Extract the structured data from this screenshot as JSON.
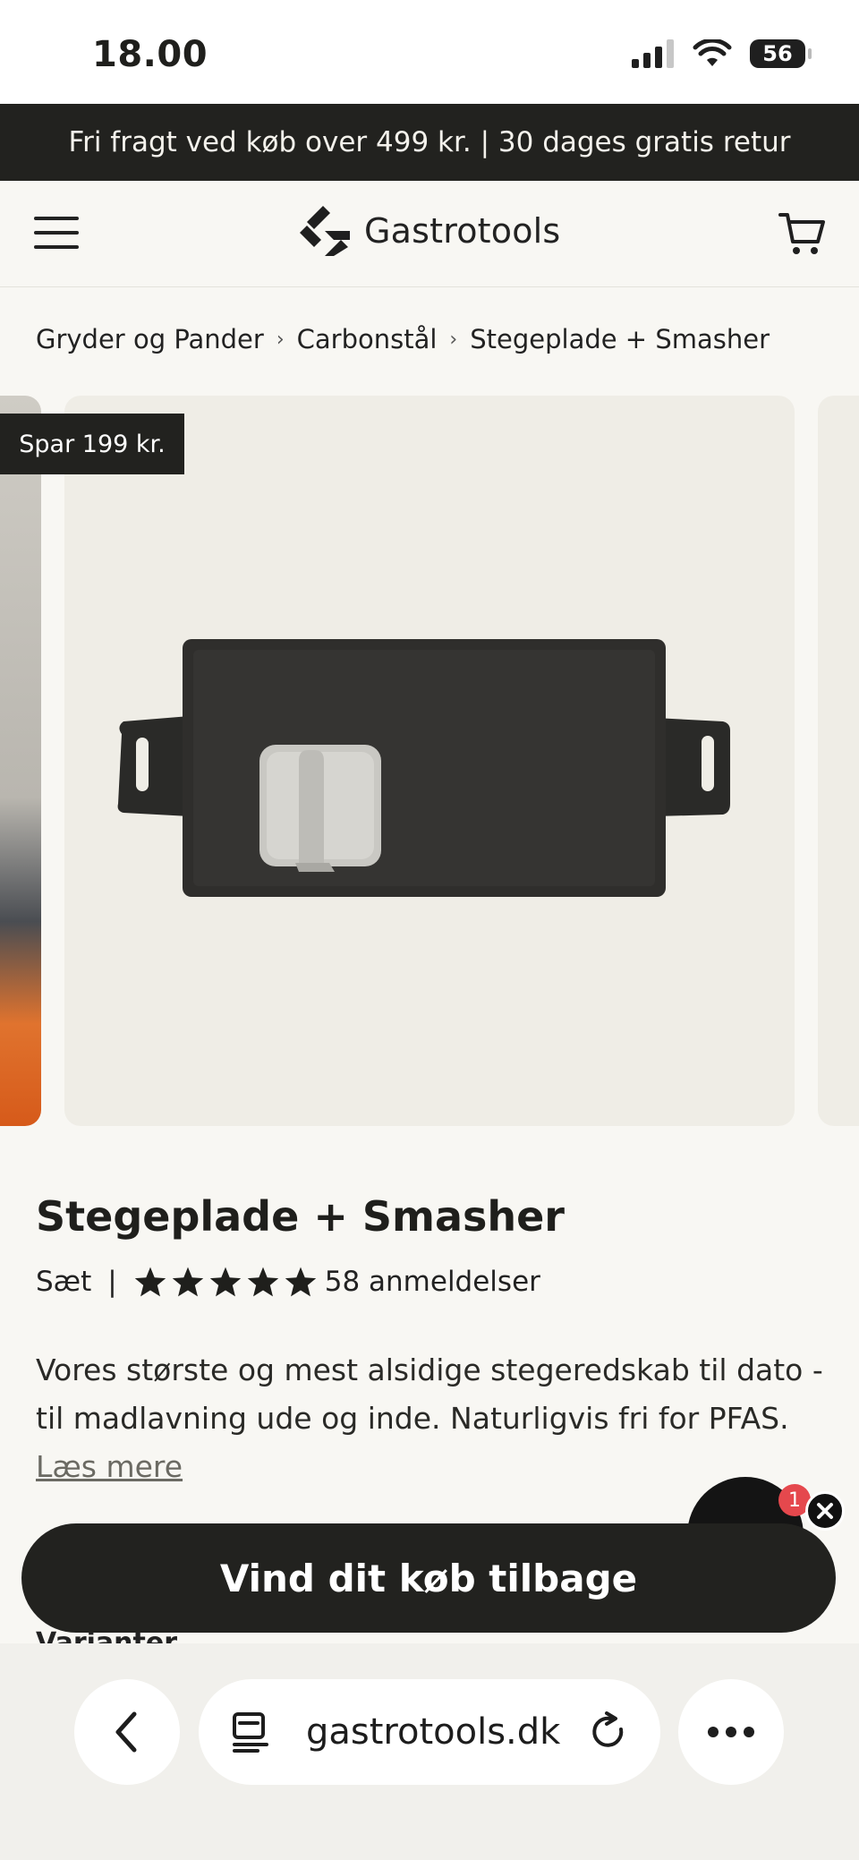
{
  "status_bar": {
    "time": "18.00",
    "battery": "56"
  },
  "promo": {
    "text": "Fri fragt ved køb over 499 kr. | 30 dages gratis retur"
  },
  "header": {
    "logo_text": "Gastrotools"
  },
  "breadcrumb": [
    "Gryder og Pander",
    "Carbonstål",
    "Stegeplade + Smasher"
  ],
  "gallery": {
    "badge": "Spar 199 kr."
  },
  "product": {
    "title": "Stegeplade + Smasher",
    "type": "Sæt",
    "separator": "|",
    "rating": 5,
    "reviews": "58 anmeldelser",
    "description": "Vores største og mest alsidige stegeredskab til dato - til madlavning ude og inde. Naturligvis fri for PFAS.",
    "read_more": "Læs mere",
    "variant_label": "Varianter"
  },
  "chat": {
    "badge_count": "1"
  },
  "cta": {
    "label": "Vind dit køb tilbage"
  },
  "browser": {
    "url": "gastrotools.dk"
  }
}
